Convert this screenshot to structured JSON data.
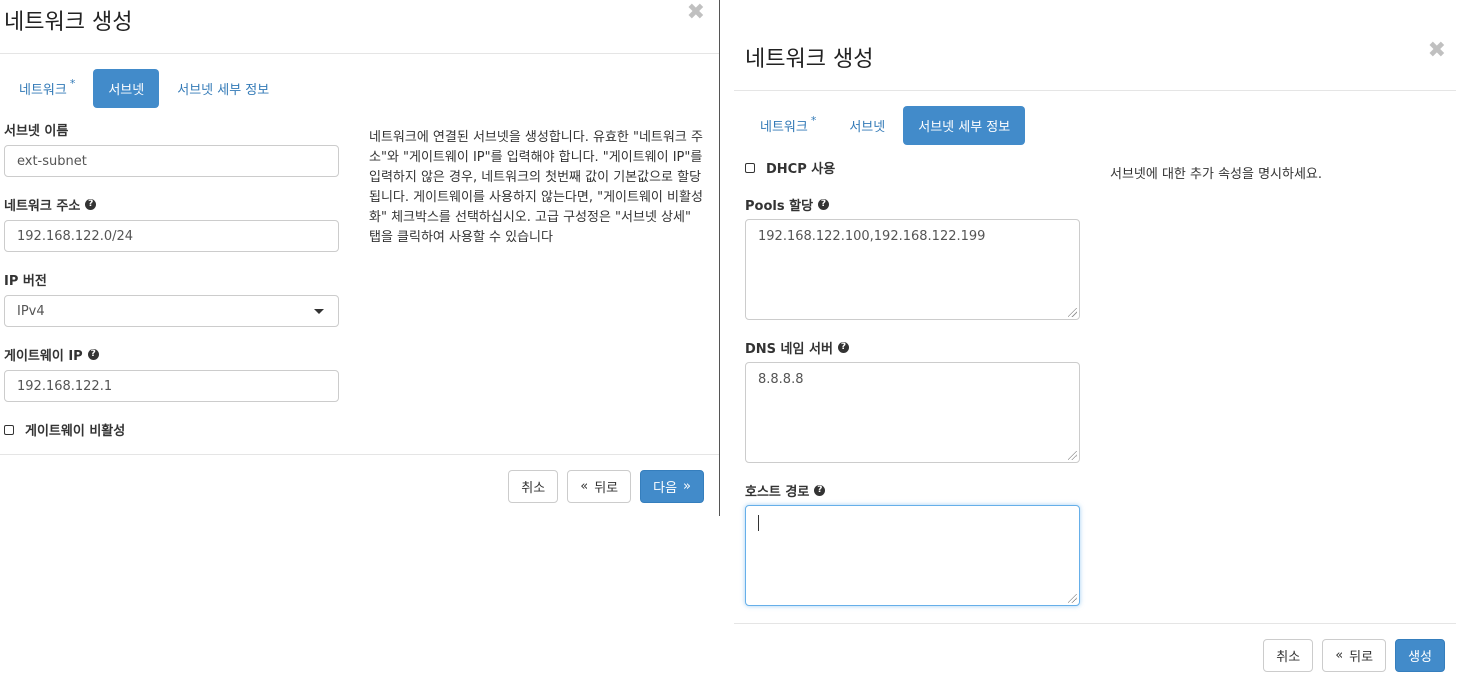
{
  "left": {
    "title": "네트워크 생성",
    "tabs": [
      {
        "label": "네트워크",
        "required_mark": "*"
      },
      {
        "label": "서브넷"
      },
      {
        "label": "서브넷 세부 정보"
      }
    ],
    "fields": {
      "subnet_name": {
        "label": "서브넷 이름",
        "value": "ext-subnet"
      },
      "network_address": {
        "label": "네트워크 주소",
        "value": "192.168.122.0/24"
      },
      "ip_version": {
        "label": "IP 버전",
        "value": "IPv4"
      },
      "gateway_ip": {
        "label": "게이트웨이 IP",
        "value": "192.168.122.1"
      },
      "disable_gateway": {
        "label": "게이트웨이 비활성",
        "checked": false
      }
    },
    "description": "네트워크에 연결된 서브넷을 생성합니다. 유효한 \"네트워크 주소\"와 \"게이트웨이 IP\"를 입력해야 합니다. \"게이트웨이 IP\"를 입력하지 않은 경우, 네트워크의 첫번째 값이 기본값으로 할당됩니다. 게이트웨이를 사용하지 않는다면, \"게이트웨이 비활성화\" 체크박스를 선택하십시오. 고급 구성정은 \"서브넷 상세\" 탭을 클릭하여 사용할 수 있습니다",
    "buttons": {
      "cancel": "취소",
      "back": "뒤로",
      "next": "다음"
    }
  },
  "right": {
    "title": "네트워크 생성",
    "tabs": [
      {
        "label": "네트워크",
        "required_mark": "*"
      },
      {
        "label": "서브넷"
      },
      {
        "label": "서브넷 세부 정보"
      }
    ],
    "fields": {
      "enable_dhcp": {
        "label": "DHCP 사용",
        "checked": false
      },
      "allocation_pools": {
        "label": "Pools 할당",
        "value": "192.168.122.100,192.168.122.199"
      },
      "dns_nameservers": {
        "label": "DNS 네임 서버",
        "value": "8.8.8.8"
      },
      "host_routes": {
        "label": "호스트 경로",
        "value": ""
      }
    },
    "description": "서브넷에 대한 추가 속성을 명시하세요.",
    "buttons": {
      "cancel": "취소",
      "back": "뒤로",
      "create": "생성"
    }
  },
  "glyphs": {
    "close": "✖",
    "help": "?",
    "laquo": "«",
    "raquo": "»"
  },
  "colors": {
    "primary": "#428bca",
    "link": "#337ab7",
    "focus": "#66afe9"
  }
}
